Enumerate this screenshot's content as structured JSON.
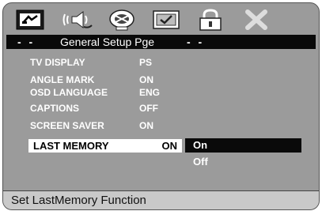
{
  "toolbar": {
    "icons": [
      "general-setup-icon",
      "audio-setup-icon",
      "video-setup-icon",
      "preference-icon",
      "password-lock-icon",
      "exit-icon"
    ]
  },
  "header": {
    "dash_left": "- -",
    "title": "General Setup P",
    "title_rest": "ge",
    "dash_right": "- -"
  },
  "menu": {
    "items": [
      {
        "label": "TV DISPLAY",
        "value": "PS"
      },
      {
        "label": "ANGLE MARK",
        "value": "ON"
      },
      {
        "label": "OSD LANGUAGE",
        "value": "ENG"
      },
      {
        "label": "CAPTIONS",
        "value": "OFF"
      },
      {
        "label": "SCREEN SAVER",
        "value": "ON"
      }
    ],
    "selected": {
      "label": "LAST MEMORY",
      "value": "ON"
    }
  },
  "options": {
    "on": "On",
    "off": "Off"
  },
  "status": {
    "text": "Set LastMemory Function"
  },
  "colors": {
    "panel": "#9b9b9b",
    "header_bg": "#0a0a0a",
    "highlight": "#ffffff",
    "status_bg": "#c9c9c9"
  }
}
